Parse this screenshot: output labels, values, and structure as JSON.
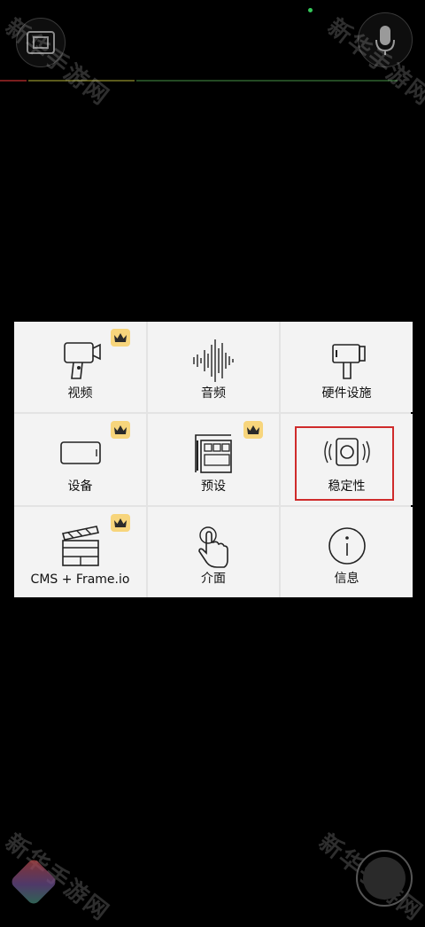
{
  "watermark_text": "新华手游网",
  "menu": {
    "items": [
      {
        "label": "视频",
        "premium": true
      },
      {
        "label": "音频",
        "premium": false
      },
      {
        "label": "硬件设施",
        "premium": false
      },
      {
        "label": "设备",
        "premium": true
      },
      {
        "label": "预设",
        "premium": true
      },
      {
        "label": "稳定性",
        "premium": false,
        "highlighted": true
      },
      {
        "label": "CMS + Frame.io",
        "premium": true
      },
      {
        "label": "介面",
        "premium": false
      },
      {
        "label": "信息",
        "premium": false
      }
    ]
  },
  "icons": {
    "top_left": "frame-icon",
    "top_right": "microphone-icon",
    "video": "video-camera-icon",
    "audio": "sound-wave-icon",
    "hardware": "camera-handle-icon",
    "device": "phone-landscape-icon",
    "presets": "preset-grid-icon",
    "stability": "stabilizer-icon",
    "cms": "clapperboard-icon",
    "interface": "tap-hand-icon",
    "info": "info-icon",
    "premium": "crown-icon"
  },
  "colors": {
    "background": "#000000",
    "panel": "#f3f3f3",
    "crown_badge": "#f7d57c",
    "highlight_border": "#cf2b2b",
    "status_dot": "#35c759"
  }
}
